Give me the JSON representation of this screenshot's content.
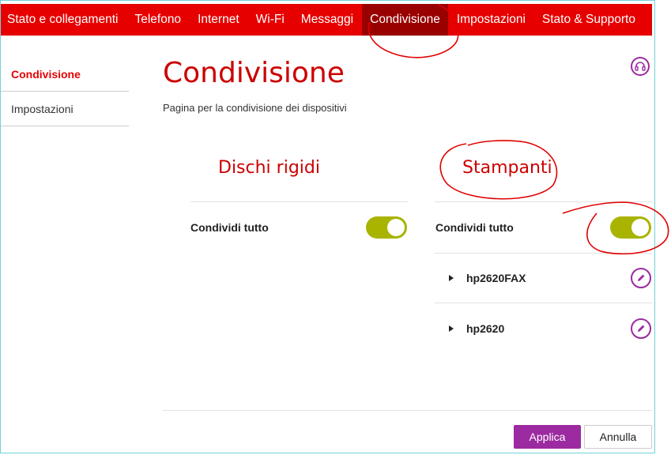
{
  "nav": {
    "items": [
      {
        "label": "Stato e collegamenti"
      },
      {
        "label": "Telefono"
      },
      {
        "label": "Internet"
      },
      {
        "label": "Wi-Fi"
      },
      {
        "label": "Messaggi"
      },
      {
        "label": "Condivisione",
        "active": true
      },
      {
        "label": "Impostazioni"
      },
      {
        "label": "Stato & Supporto"
      }
    ]
  },
  "sidebar": {
    "items": [
      {
        "label": "Condivisione",
        "active": true
      },
      {
        "label": "Impostazioni"
      }
    ]
  },
  "main": {
    "title": "Condivisione",
    "description": "Pagina per la condivisione dei dispositivi",
    "disks": {
      "title": "Dischi rigidi",
      "share_all_label": "Condividi tutto",
      "share_all_on": true
    },
    "printers": {
      "title": "Stampanti",
      "share_all_label": "Condividi tutto",
      "share_all_on": true,
      "devices": [
        {
          "name": "hp2620FAX"
        },
        {
          "name": "hp2620"
        }
      ]
    }
  },
  "actions": {
    "apply_label": "Applica",
    "cancel_label": "Annulla"
  },
  "colors": {
    "brand_red": "#e60000",
    "active_tab": "#990000",
    "accent_purple": "#9c2aa0",
    "toggle_on": "#a8b400",
    "annotation_red": "#e00000"
  },
  "icons": {
    "help": "headset-icon",
    "edit": "pencil-icon",
    "expand": "caret-right-icon"
  }
}
